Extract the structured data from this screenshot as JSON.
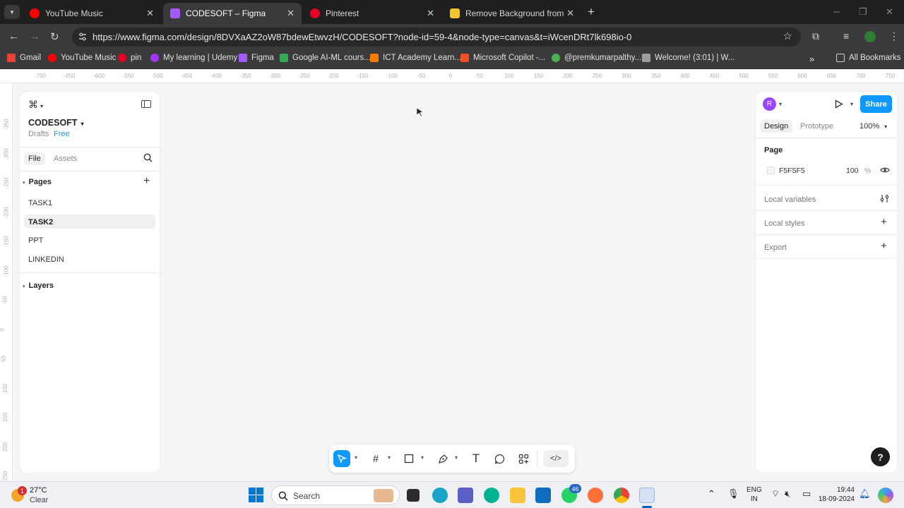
{
  "tabs": [
    {
      "label": "YouTube Music",
      "color": "#ff0000"
    },
    {
      "label": "CODESOFT – Figma",
      "color": "#a259ff"
    },
    {
      "label": "Pinterest",
      "color": "#e60023"
    },
    {
      "label": "Remove Background from Imag",
      "color": "#f4c430"
    }
  ],
  "url": "https://www.figma.com/design/8DVXaAZ2oW87bdewEtwvzH/CODESOFT?node-id=59-4&node-type=canvas&t=iWcenDRt7lk698io-0",
  "bookmarks": [
    {
      "label": "Gmail",
      "color": "#ea4335"
    },
    {
      "label": "YouTube Music",
      "color": "#ff0000"
    },
    {
      "label": "pin",
      "color": "#e60023"
    },
    {
      "label": "My learning | Udemy",
      "color": "#a435f0"
    },
    {
      "label": "Figma",
      "color": "#a259ff"
    },
    {
      "label": "Google AI-ML cours...",
      "color": "#34a853"
    },
    {
      "label": "ICT Academy Learn...",
      "color": "#f57c00"
    },
    {
      "label": "Microsoft Copilot -...",
      "color": "#f25022"
    },
    {
      "label": "@premkumarpalthy...",
      "color": "#4caf50"
    },
    {
      "label": "Welcome! (3:01) | W...",
      "color": "#9e9e9e"
    }
  ],
  "all_bookmarks": "All Bookmarks",
  "ruler_top": [
    "-700",
    "-650",
    "-600",
    "-550",
    "-500",
    "-450",
    "-400",
    "-350",
    "-300",
    "-250",
    "-200",
    "-150",
    "-100",
    "-50",
    "0",
    "50",
    "100",
    "150",
    "200",
    "250",
    "300",
    "350",
    "400",
    "450",
    "500",
    "550",
    "600",
    "650",
    "700",
    "750"
  ],
  "ruler_left": [
    "-350",
    "-300",
    "-250",
    "-200",
    "-150",
    "-100",
    "-50",
    "0",
    "50",
    "100",
    "150",
    "200",
    "250"
  ],
  "left": {
    "file_name": "CODESOFT",
    "drafts": "Drafts",
    "plan": "Free",
    "tab_file": "File",
    "tab_assets": "Assets",
    "pages_label": "Pages",
    "pages": [
      "TASK1",
      "TASK2",
      "PPT",
      "LINKEDIN"
    ],
    "layers_label": "Layers"
  },
  "right": {
    "avatar": "R",
    "share": "Share",
    "tab_design": "Design",
    "tab_prototype": "Prototype",
    "zoom": "100%",
    "page_label": "Page",
    "bg_hex": "F5F5F5",
    "bg_opacity": "100",
    "pct": "%",
    "local_variables": "Local variables",
    "local_styles": "Local styles",
    "export": "Export"
  },
  "taskbar": {
    "temp": "27°C",
    "weather": "Clear",
    "weather_badge": "1",
    "search": "Search",
    "whatsapp_badge": "46",
    "lang1": "ENG",
    "lang2": "IN",
    "time": "19:44",
    "date": "18-09-2024"
  }
}
